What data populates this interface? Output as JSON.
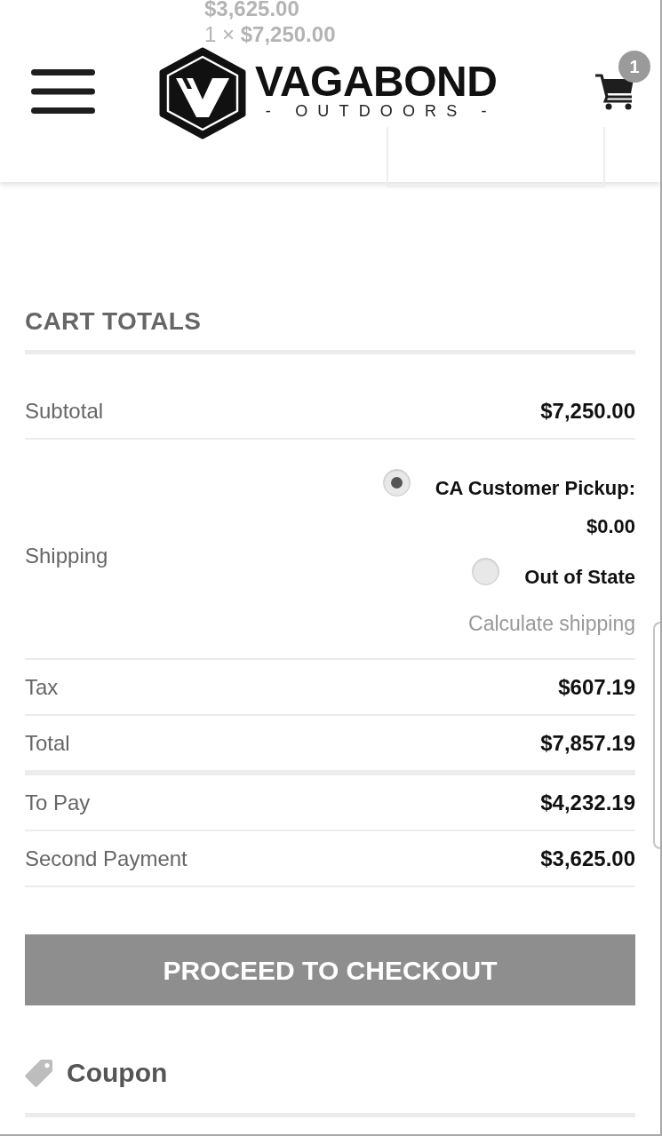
{
  "background_content": {
    "price": "$3,625.00",
    "line_total": "1 × **$7,250.00**"
  },
  "header": {
    "brand": "VAGABOND",
    "tagline": "- OUTDOORS -",
    "cart_count": "1"
  },
  "cart_totals": {
    "title": "CART TOTALS",
    "rows": [
      {
        "kind": "amount",
        "label": "Subtotal",
        "value": "$7,250.00"
      },
      {
        "kind": "shipping",
        "label": "Shipping",
        "options": [
          {
            "label": "CA Customer Pickup:",
            "price": "$0.00",
            "selected": true
          },
          {
            "label": "Out of State",
            "selected": false
          }
        ],
        "calculate_link": "Calculate shipping"
      },
      {
        "kind": "amount",
        "label": "Tax",
        "value": "$607.19"
      },
      {
        "kind": "total",
        "label": "Total",
        "value": "$7,857.19"
      },
      {
        "kind": "amount",
        "label": "To Pay",
        "value": "$4,232.19"
      },
      {
        "kind": "amount",
        "label": "Second Payment",
        "value": "$3,625.00"
      }
    ]
  },
  "checkout_button": "PROCEED TO CHECKOUT",
  "coupon": {
    "title": "Coupon"
  }
}
